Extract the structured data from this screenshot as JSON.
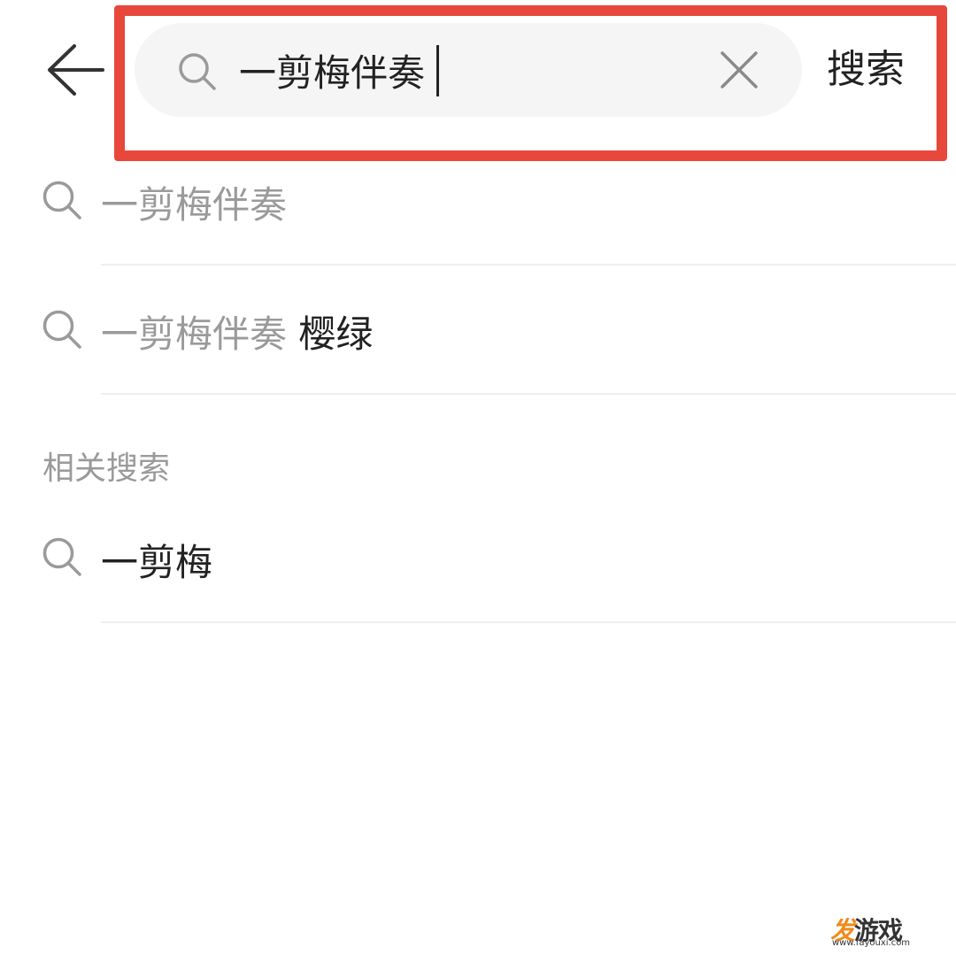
{
  "header": {
    "back_icon": "arrow-left-icon",
    "search": {
      "icon": "search-icon",
      "value": "一剪梅伴奏",
      "placeholder": ""
    },
    "clear_icon": "close-icon",
    "submit_label": "搜索"
  },
  "suggestions": [
    {
      "matched": "一剪梅伴奏",
      "rest": ""
    },
    {
      "matched": "一剪梅伴奏",
      "rest": " 樱绿"
    }
  ],
  "related": {
    "heading": "相关搜索",
    "items": [
      {
        "label": "一剪梅"
      }
    ]
  },
  "watermark": {
    "logo_part1": "发",
    "logo_part2": "游戏",
    "url": "www.fayouxi.com"
  },
  "colors": {
    "annotation": "#e8473b",
    "muted_text": "#9a9a9a",
    "primary_text": "#222222",
    "search_bg": "#f5f5f5",
    "watermark_accent": "#f08a1c"
  }
}
